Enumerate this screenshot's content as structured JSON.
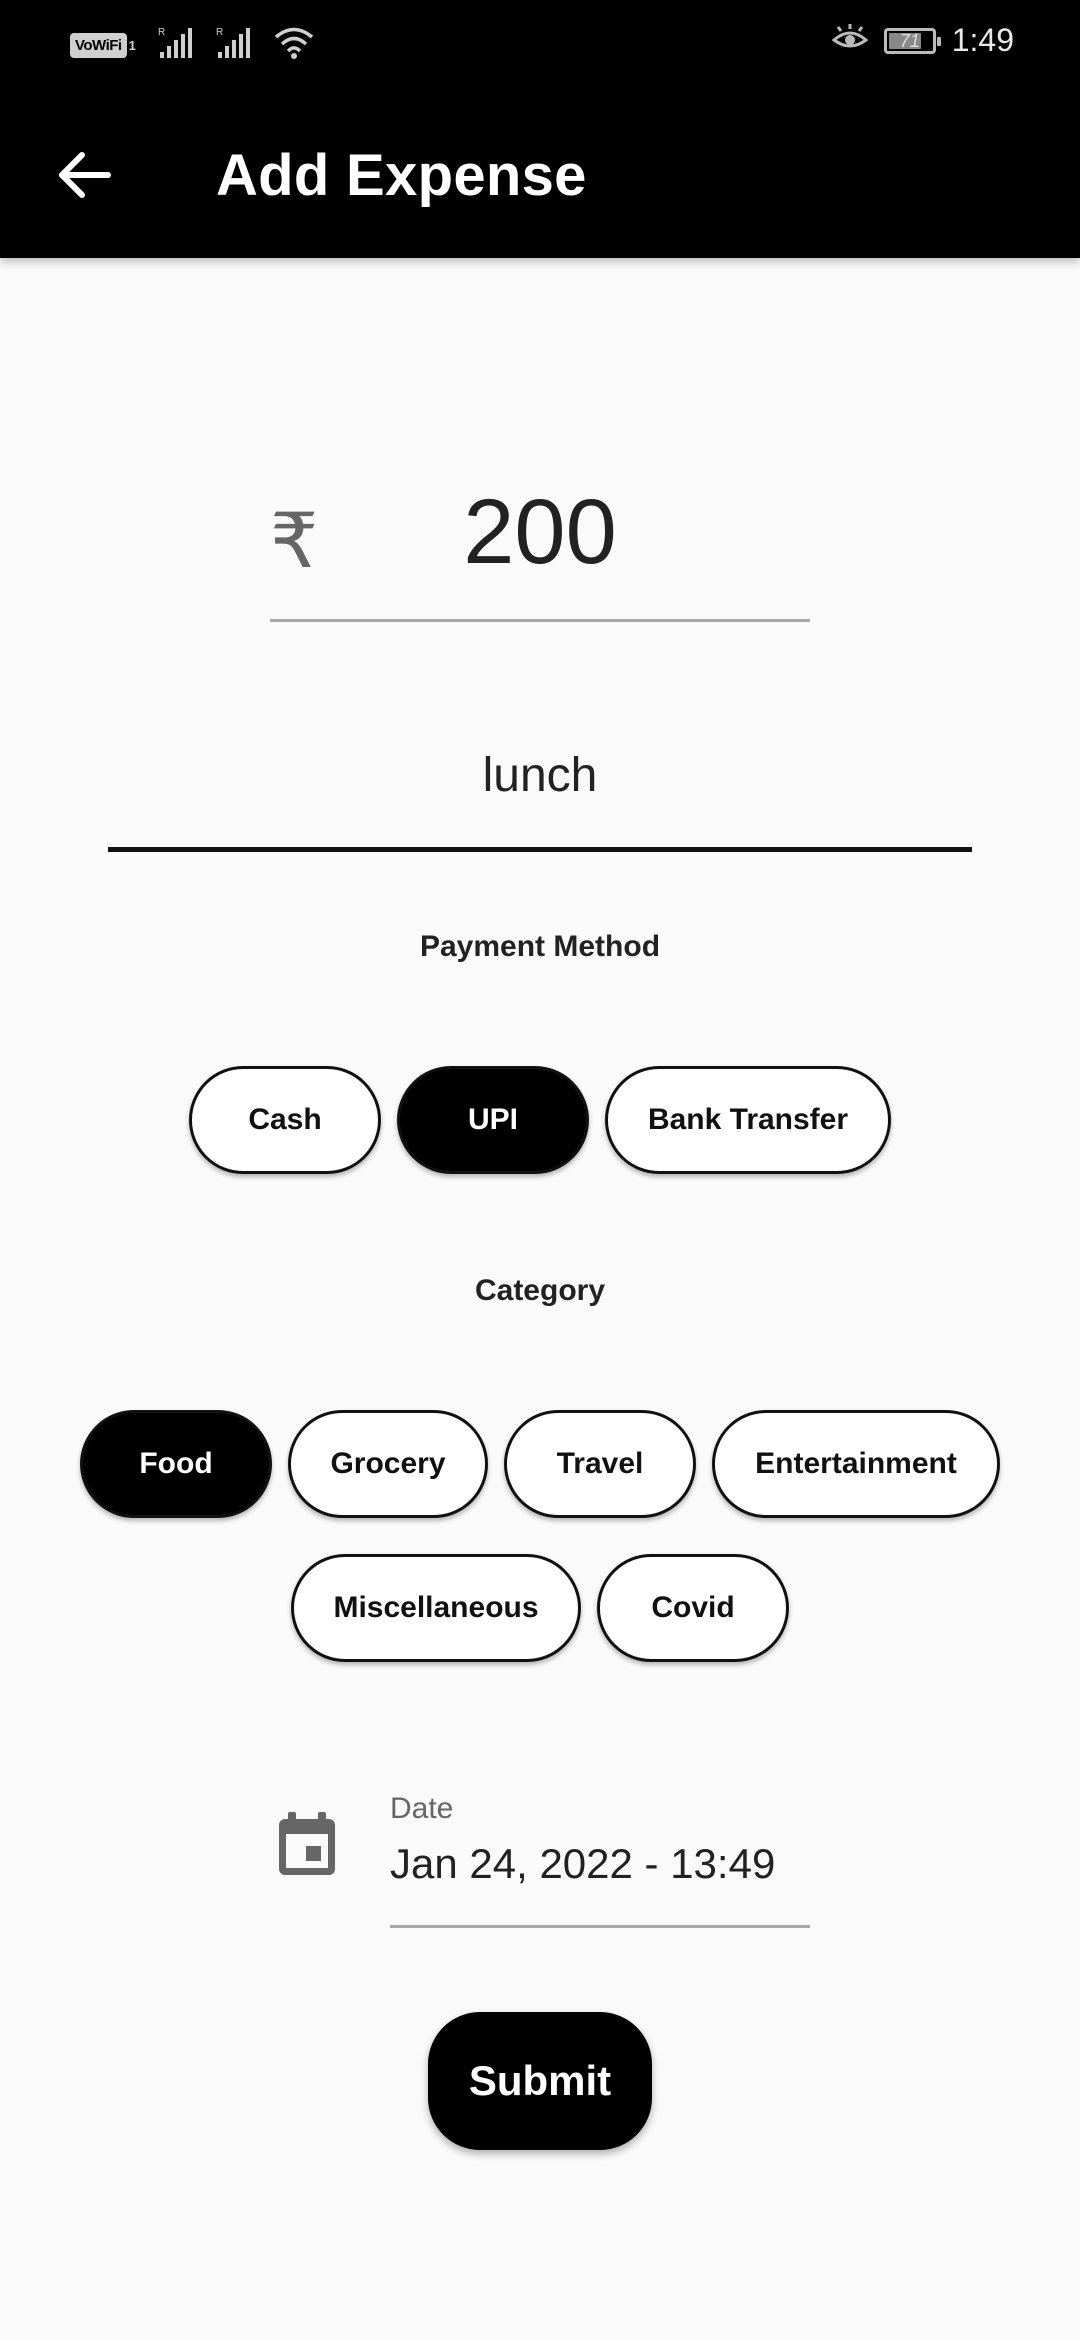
{
  "status_bar": {
    "network_label": "VoWiFi",
    "sim_index": "1",
    "signal_1_roaming": "R",
    "signal_2_roaming": "R",
    "battery_level": "71",
    "battery_fraction": 0.71,
    "time": "1:49"
  },
  "app_bar": {
    "back_icon": "arrow-left-icon",
    "title": "Add Expense"
  },
  "amount": {
    "currency_symbol": "₹",
    "value": "200"
  },
  "note": {
    "value": "lunch"
  },
  "payment_method": {
    "label": "Payment Method",
    "options": [
      "Cash",
      "UPI",
      "Bank Transfer"
    ],
    "selected": "UPI"
  },
  "category": {
    "label": "Category",
    "options": [
      "Food",
      "Grocery",
      "Travel",
      "Entertainment",
      "Miscellaneous",
      "Covid"
    ],
    "selected": "Food"
  },
  "date": {
    "icon": "calendar-icon",
    "label": "Date",
    "value": "Jan 24, 2022 - 13:49"
  },
  "submit_label": "Submit",
  "colors": {
    "primary": "#000000",
    "background": "#fafafa",
    "chip_background": "#ffffff"
  }
}
